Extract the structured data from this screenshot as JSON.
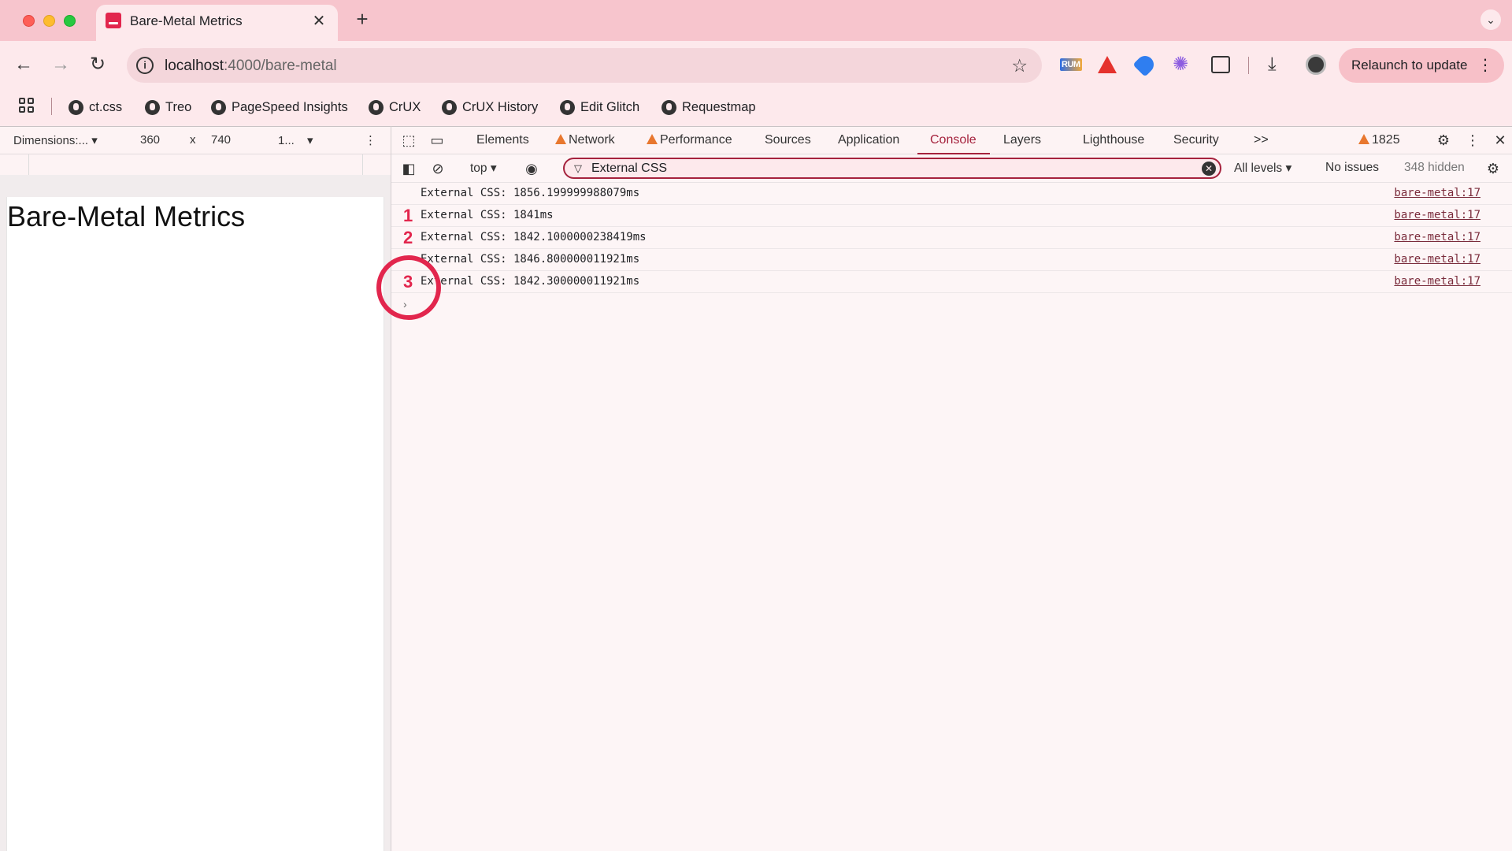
{
  "browser": {
    "tab_title": "Bare-Metal Metrics",
    "tab_close": "✕",
    "new_tab": "+",
    "url_host": "localhost",
    "url_path": ":4000/bare-metal",
    "relaunch_label": "Relaunch to update",
    "ext_rum_label": "RUM",
    "bookmarks": [
      "ct.css",
      "Treo",
      "PageSpeed Insights",
      "CrUX",
      "CrUX History",
      "Edit Glitch",
      "Requestmap"
    ]
  },
  "device_toolbar": {
    "dimensions_label": "Dimensions:...",
    "width": "360",
    "times": "x",
    "height": "740",
    "zoom": "1..."
  },
  "page": {
    "heading": "Bare-Metal Metrics"
  },
  "devtools": {
    "tabs": [
      "Elements",
      "Network",
      "Performance",
      "Sources",
      "Application",
      "Console",
      "Layers",
      "Lighthouse",
      "Security"
    ],
    "active_tab": "Console",
    "more_tabs": ">>",
    "warning_count": "1825",
    "context": "top",
    "filter_value": "External CSS",
    "levels": "All levels",
    "issues": "No issues",
    "hidden": "348 hidden",
    "logs": [
      {
        "badge": "",
        "message": "External CSS: 1856.199999988079ms",
        "source": "bare-metal:17"
      },
      {
        "badge": "1",
        "message": "External CSS: 1841ms",
        "source": "bare-metal:17"
      },
      {
        "badge": "2",
        "message": "External CSS: 1842.1000000238419ms",
        "source": "bare-metal:17"
      },
      {
        "badge": "",
        "message": "External CSS: 1846.800000011921ms",
        "source": "bare-metal:17"
      },
      {
        "badge": "3",
        "message": "External CSS: 1842.300000011921ms",
        "source": "bare-metal:17"
      }
    ],
    "prompt": "›"
  },
  "colors": {
    "chrome_bg": "#f7c5cd",
    "toolbar_bg": "#fde9ec",
    "accent": "#a5223d",
    "annotation": "#e2264d"
  }
}
